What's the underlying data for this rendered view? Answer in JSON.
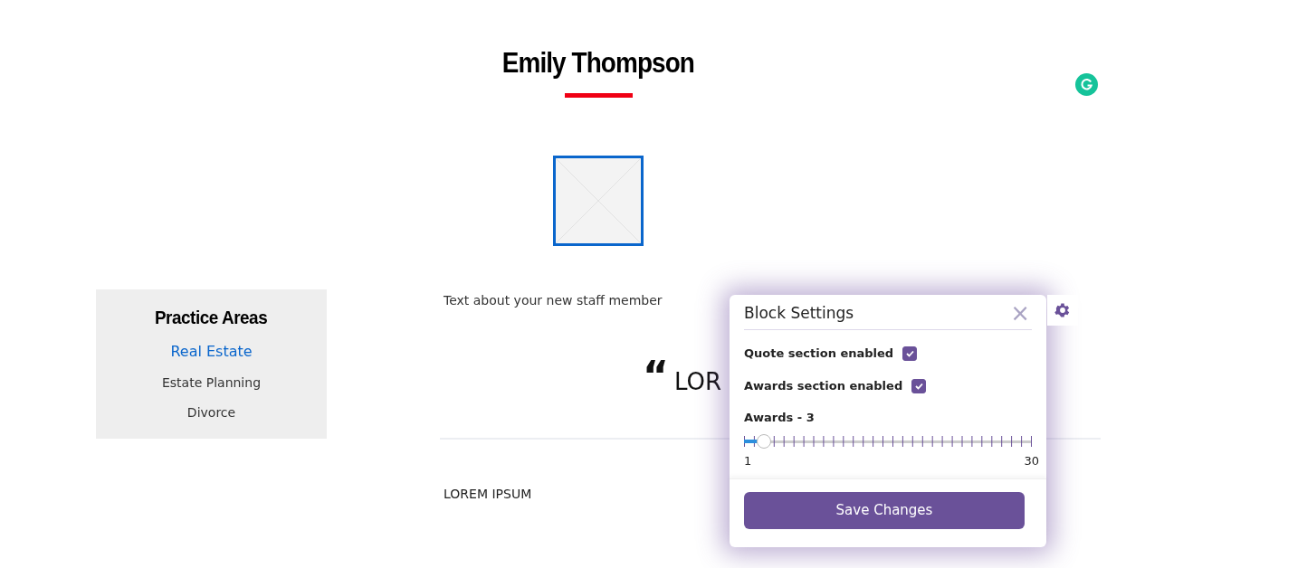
{
  "profile": {
    "name": "Emily Thompson"
  },
  "intro": "Text about your new staff member",
  "quote": {
    "mark": "“",
    "text": "LOR"
  },
  "section_heading": "LOREM IPSUM",
  "sidebar": {
    "title": "Practice Areas",
    "items": [
      {
        "label": "Real Estate",
        "selected": true
      },
      {
        "label": "Estate Planning",
        "selected": false
      },
      {
        "label": "Divorce",
        "selected": false
      }
    ]
  },
  "block_settings": {
    "title": "Block Settings",
    "close": "×",
    "options": [
      {
        "label": "Quote section enabled",
        "checked": true
      },
      {
        "label": "Awards section enabled",
        "checked": true
      }
    ],
    "slider": {
      "label": "Awards - 3",
      "level": 0.069,
      "min_label": "1",
      "max_label": "30"
    },
    "save_button": "Save Changes"
  }
}
